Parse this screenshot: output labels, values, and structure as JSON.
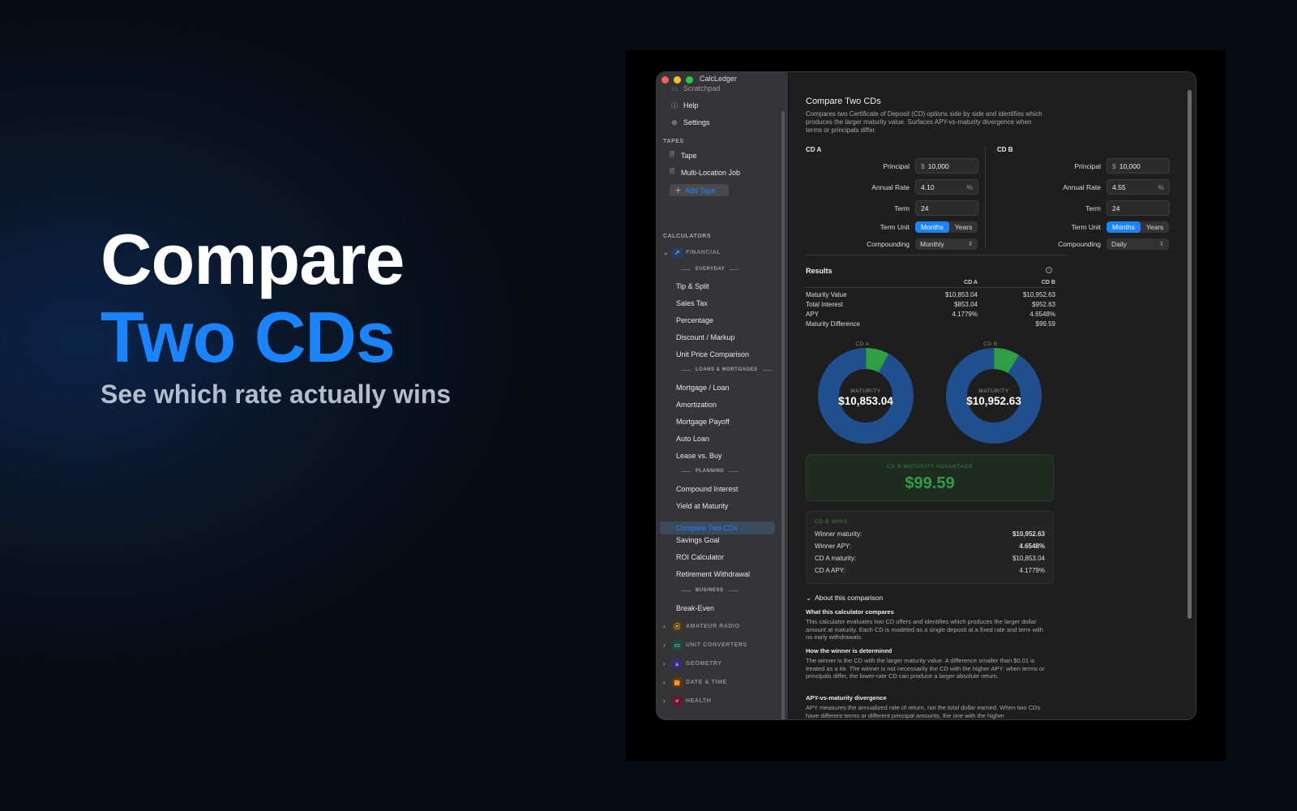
{
  "hero": {
    "line1": "Compare",
    "line2": "Two CDs",
    "tagline": "See which rate actually wins"
  },
  "window": {
    "title": "CalcLedger"
  },
  "sidebar": {
    "top_items": [
      {
        "label": "Scratchpad",
        "icon": "scratchpad-icon"
      },
      {
        "label": "Help",
        "icon": "help-icon"
      },
      {
        "label": "Settings",
        "icon": "gear-icon"
      }
    ],
    "tapes_header": "TAPES",
    "tapes": [
      {
        "label": "Tape"
      },
      {
        "label": "Multi-Location Job"
      }
    ],
    "add_tape": "Add Tape",
    "calculators_header": "CALCULATORS",
    "financial_label": "FINANCIAL",
    "sub_everyday": "EVERYDAY",
    "everyday": [
      "Tip & Split",
      "Sales Tax",
      "Percentage",
      "Discount / Markup",
      "Unit Price Comparison"
    ],
    "sub_loans": "LOANS & MORTGAGES",
    "loans": [
      "Mortgage / Loan",
      "Amortization",
      "Mortgage Payoff",
      "Auto Loan",
      "Lease vs. Buy"
    ],
    "sub_planning": "PLANNING",
    "planning": [
      "Compound Interest",
      "Yield at Maturity",
      "Compare Two CDs",
      "Savings Goal",
      "ROI Calculator",
      "Retirement Withdrawal"
    ],
    "sub_business": "BUSINESS",
    "business": [
      "Break-Even"
    ],
    "groups": [
      "AMATEUR RADIO",
      "UNIT CONVERTERS",
      "GEOMETRY",
      "DATE & TIME",
      "HEALTH"
    ],
    "selected": "Compare Two CDs"
  },
  "page": {
    "title": "Compare Two CDs",
    "description": "Compares two Certificate of Deposit (CD) options side by side and identifies which produces the larger maturity value. Surfaces APY-vs-maturity divergence when terms or principals differ."
  },
  "form": {
    "labels": {
      "principal": "Principal",
      "rate": "Annual Rate",
      "term": "Term",
      "term_unit": "Term Unit",
      "compounding": "Compounding"
    },
    "currency_symbol": "$",
    "percent_symbol": "%",
    "unit_months": "Months",
    "unit_years": "Years",
    "cd_a": {
      "header": "CD A",
      "principal": "10,000",
      "rate": "4.10",
      "term": "24",
      "term_unit": "Months",
      "compounding": "Monthly"
    },
    "cd_b": {
      "header": "CD B",
      "principal": "10,000",
      "rate": "4.55",
      "term": "24",
      "term_unit": "Months",
      "compounding": "Daily"
    }
  },
  "results": {
    "title": "Results",
    "col_a": "CD A",
    "col_b": "CD B",
    "rows": [
      {
        "label": "Maturity Value",
        "a": "$10,853.04",
        "b": "$10,952.63"
      },
      {
        "label": "Total Interest",
        "a": "$853.04",
        "b": "$952.63"
      },
      {
        "label": "APY",
        "a": "4.1779%",
        "b": "4.6548%"
      },
      {
        "label": "Maturity Difference",
        "a": "",
        "b": "$99.59"
      }
    ]
  },
  "donuts": {
    "center_label": "MATURITY",
    "a": {
      "label": "CD A",
      "value": "$10,853.04",
      "principal_fraction": 0.9214,
      "interest_fraction": 0.0786
    },
    "b": {
      "label": "CD B",
      "value": "$10,952.63",
      "principal_fraction": 0.913,
      "interest_fraction": 0.087
    },
    "colors": {
      "principal": "#1f4f8e",
      "interest": "#2ea043"
    }
  },
  "advantage": {
    "label": "CD B MATURITY ADVANTAGE",
    "value": "$99.59"
  },
  "winner": {
    "label": "CD B WINS",
    "rows": [
      {
        "k": "Winner maturity:",
        "v": "$10,952.63"
      },
      {
        "k": "Winner APY:",
        "v": "4.6548%"
      },
      {
        "k": "CD A maturity:",
        "v": "$10,853.04"
      },
      {
        "k": "CD A APY:",
        "v": "4.1779%"
      }
    ]
  },
  "about": {
    "toggle": "About this comparison",
    "sections": [
      {
        "h": "What this calculator compares",
        "p": "This calculator evaluates two CD offers and identifies which produces the larger dollar amount at maturity. Each CD is modeled as a single deposit at a fixed rate and term with no early withdrawals."
      },
      {
        "h": "How the winner is determined",
        "p": "The winner is the CD with the larger maturity value. A difference smaller than $0.01 is treated as a tie. The winner is not necessarily the CD with the higher APY: when terms or principals differ, the lower-rate CD can produce a larger absolute return."
      },
      {
        "h": "APY-vs-maturity divergence",
        "p": "APY measures the annualized rate of return, not the total dollar earned. When two CDs have different terms or different principal amounts, the one with the higher"
      }
    ]
  },
  "colors": {
    "accent": "#1a84ff",
    "win_green": "#2ea043"
  }
}
